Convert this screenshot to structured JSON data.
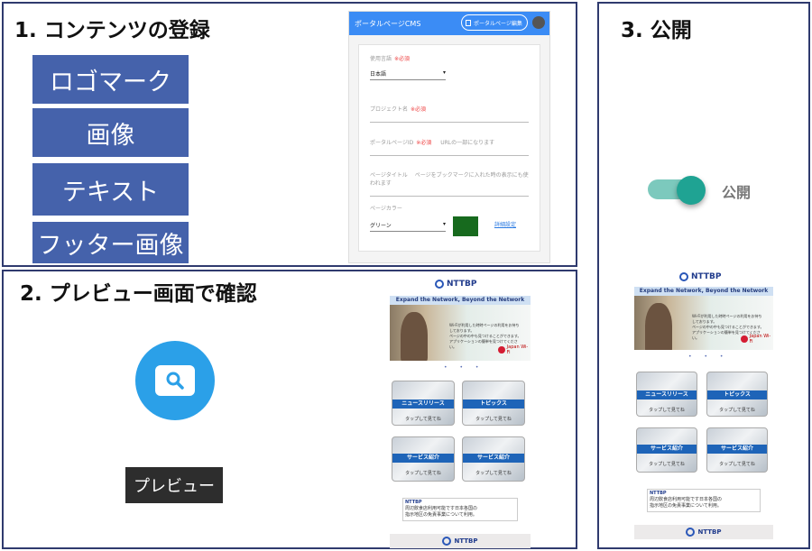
{
  "step1": {
    "title": "1. コンテンツの登録",
    "items": [
      "ロゴマーク",
      "画像",
      "テキスト",
      "フッター画像"
    ]
  },
  "step2": {
    "title": "2. プレビュー画面で確認",
    "preview_button": "プレビュー"
  },
  "step3": {
    "title": "3. 公開",
    "toggle_label": "公開",
    "toggle_state": "on"
  },
  "cms": {
    "app_title": "ポータルページCMS",
    "edit_button": "ポータルページ編集",
    "required_mark": "※必須",
    "language_label": "使用言語",
    "language_value": "日本語",
    "project_label": "プロジェクト名",
    "portal_id_label": "ポータルページID",
    "portal_id_hint": "URLの一部になります",
    "page_title_label": "ページタイトル",
    "page_title_hint": "ページをブックマークに入れた時の表示にも使われます",
    "color_label": "ページカラー",
    "color_value": "グリーン",
    "color_swatch": "#176a1e",
    "advanced_link": "詳細設定"
  },
  "site": {
    "logo_text": "NTTBP",
    "tagline": "Expand the Network, Beyond the Network",
    "hero_text": [
      "Wi-Fiが利用した時時ページの利用をお待ちしております。",
      "ページの中の中も見つけることができます。",
      "アプリケーションの簡単を見つけてください。"
    ],
    "japan_wifi": "Japan Wi-Fi",
    "dots": "• • •",
    "tiles": [
      {
        "label": "ニュースリリース",
        "sub": "タップして見てね"
      },
      {
        "label": "トピックス",
        "sub": "タップして見てね"
      },
      {
        "label": "サービス紹介",
        "sub": "タップして見てね"
      },
      {
        "label": "サービス紹介",
        "sub": "タップして見てね"
      }
    ],
    "ad_lines": [
      "NTTBP",
      "周辺飲食店利用可能です日本各国の",
      "指示地区の免責事業について利用。"
    ],
    "footer_logo": "NTTBP"
  },
  "colors": {
    "panel_border": "#2f3a6e",
    "step_button": "#4562ab",
    "cms_bar": "#3b8cf5",
    "toggle_track": "#7cc9bd",
    "toggle_knob": "#1fa393",
    "preview_circle": "#2ba0e8"
  }
}
